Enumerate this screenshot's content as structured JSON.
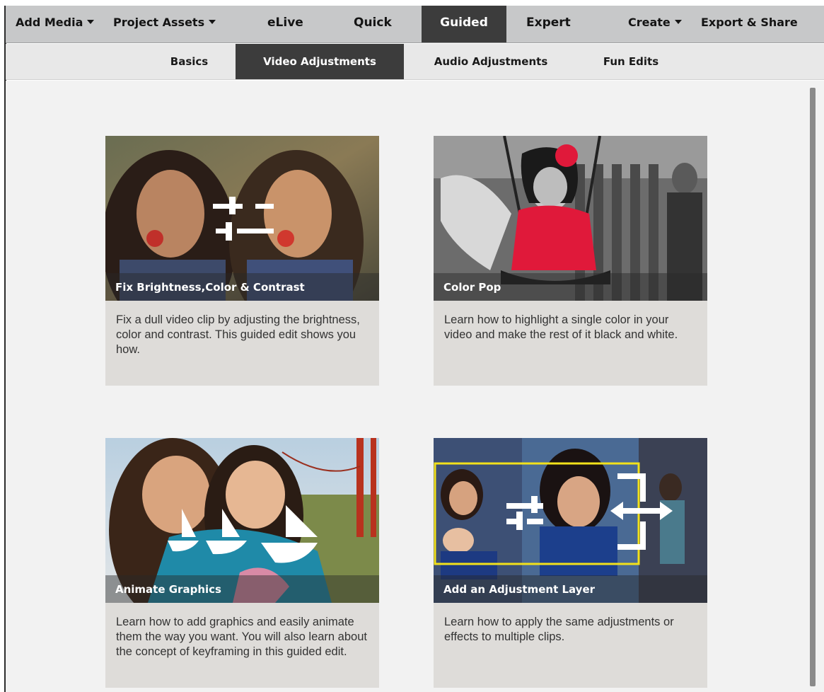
{
  "topbar": {
    "add_media": "Add Media",
    "project_assets": "Project Assets",
    "elive": "eLive",
    "quick": "Quick",
    "guided": "Guided",
    "expert": "Expert",
    "create": "Create",
    "export_share": "Export & Share",
    "active_tab": "Guided"
  },
  "subtabs": {
    "items": [
      "Basics",
      "Video Adjustments",
      "Audio Adjustments",
      "Fun Edits"
    ],
    "active": "Video Adjustments"
  },
  "cards": [
    {
      "title": "Fix Brightness,Color & Contrast",
      "description": "Fix a dull video clip by adjusting the brightness, color and contrast. This guided edit shows you how.",
      "icon": "sliders-icon"
    },
    {
      "title": "Color Pop",
      "description": "Learn how to highlight a single color in your video and make the rest of it black and white.",
      "icon": "none"
    },
    {
      "title": "Animate Graphics",
      "description": "Learn how to add graphics and easily animate them the way you want. You will also learn about the concept of keyframing in this guided edit.",
      "icon": "sailboats-icon"
    },
    {
      "title": "Add an Adjustment Layer",
      "description": "Learn how to apply the same adjustments or effects to multiple clips.",
      "icon": "adjustment-layer-icon"
    }
  ],
  "colors": {
    "topbar_bg": "#c7c8c9",
    "active_tab_bg": "#3c3c3c",
    "subbar_bg": "#e8e8e8",
    "content_bg": "#f2f2f2",
    "card_bg": "#dedcd9",
    "adjustment_frame": "#f2e11b",
    "color_pop_red": "#e0193a"
  }
}
